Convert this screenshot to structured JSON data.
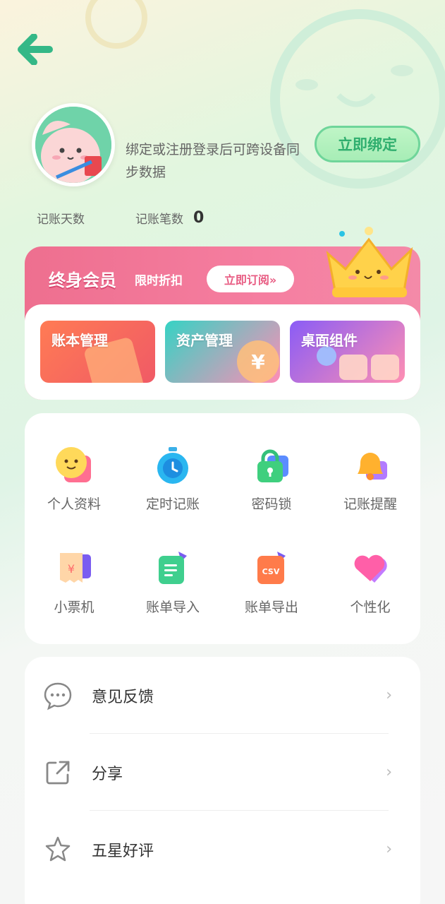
{
  "header": {
    "back_icon": "arrow-left-icon"
  },
  "profile": {
    "login_tip": "绑定或注册登录后可跨设备同步数据",
    "bind_button": "立即绑定"
  },
  "stats": [
    {
      "label": "记账天数",
      "value": ""
    },
    {
      "label": "记账笔数",
      "value": "0"
    }
  ],
  "vip": {
    "title": "终身会员",
    "subtitle": "限时折扣",
    "subscribe_button": "立即订阅»",
    "tiles": [
      {
        "label": "账本管理",
        "color_from": "#ff7b54",
        "color_to": "#f05a66"
      },
      {
        "label": "资产管理",
        "color_from": "#35d3c4",
        "color_to": "#ff8db6"
      },
      {
        "label": "桌面组件",
        "color_from": "#8a5cf6",
        "color_to": "#ff8fb2"
      }
    ]
  },
  "features": [
    {
      "label": "个人资料",
      "icon": "smiley-face-icon"
    },
    {
      "label": "定时记账",
      "icon": "alarm-clock-icon"
    },
    {
      "label": "密码锁",
      "icon": "padlock-icon"
    },
    {
      "label": "记账提醒",
      "icon": "bell-icon"
    },
    {
      "label": "小票机",
      "icon": "receipt-icon"
    },
    {
      "label": "账单导入",
      "icon": "bill-import-icon"
    },
    {
      "label": "账单导出",
      "icon": "csv-export-icon"
    },
    {
      "label": "个性化",
      "icon": "heart-icon"
    }
  ],
  "menu": [
    {
      "label": "意见反馈",
      "icon": "chat-bubble-icon"
    },
    {
      "label": "分享",
      "icon": "share-icon"
    },
    {
      "label": "五星好评",
      "icon": "star-icon"
    }
  ],
  "colors": {
    "accent_green": "#2fae6e",
    "vip_pink": "#f07896"
  }
}
